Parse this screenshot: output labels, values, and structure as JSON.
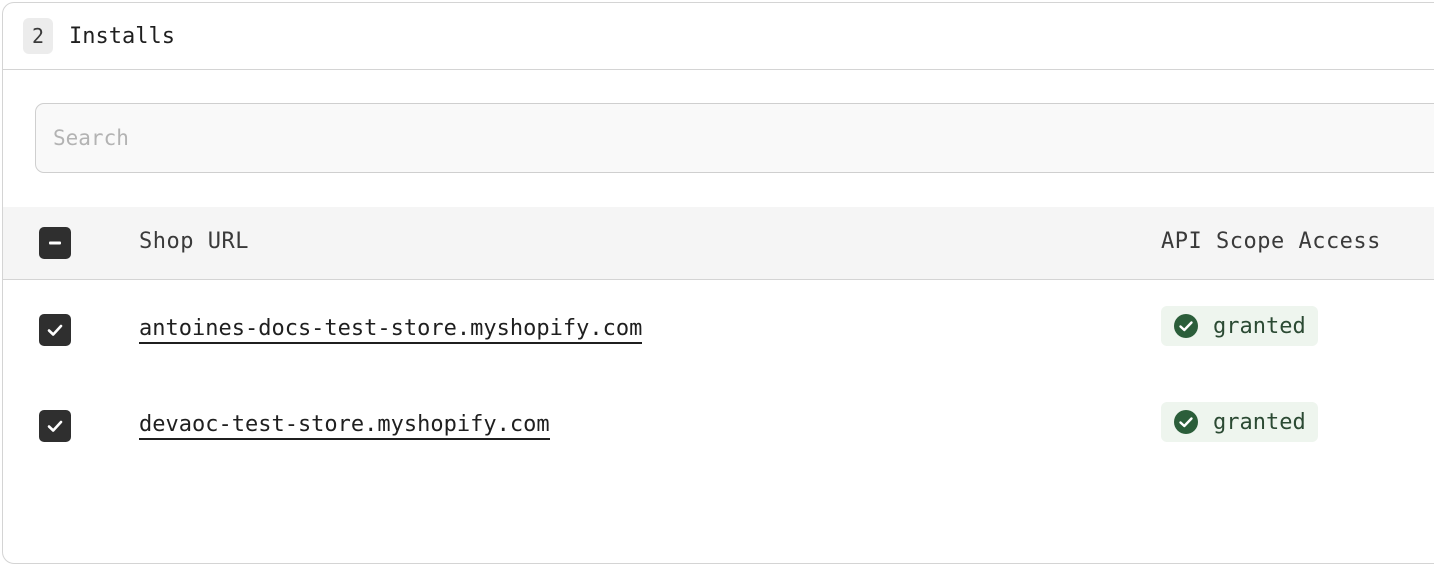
{
  "header": {
    "count": "2",
    "title": "Installs"
  },
  "search": {
    "placeholder": "Search",
    "value": ""
  },
  "table": {
    "columns": {
      "shop_url": "Shop URL",
      "api_scope": "API Scope Access"
    },
    "rows": [
      {
        "shop_url": "antoines-docs-test-store.myshopify.com",
        "scope_status": "granted",
        "selected": true
      },
      {
        "shop_url": "devaoc-test-store.myshopify.com",
        "scope_status": "granted",
        "selected": true
      }
    ]
  },
  "icons": {
    "select_all": "minus-checkbox-icon",
    "row_checkbox": "checkmark-icon",
    "granted": "check-circle-icon"
  },
  "colors": {
    "checkbox": "#2f2f2f",
    "granted_bg": "#eef5ee",
    "granted_icon": "#2b5e3a",
    "granted_text": "#2b4a33"
  }
}
